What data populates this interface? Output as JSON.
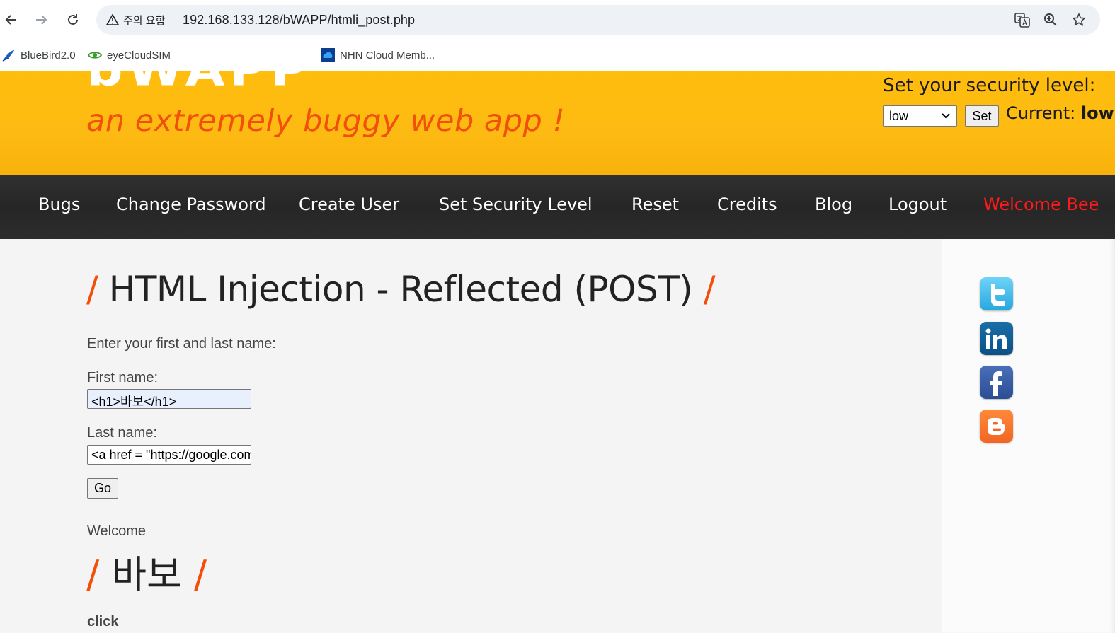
{
  "browser": {
    "security_chip": "주의 요함",
    "url": "192.168.133.128/bWAPP/htmli_post.php",
    "bookmarks": [
      "BlueBird2.0",
      "eyeCloudSIM",
      "NHN Cloud Memb..."
    ]
  },
  "header": {
    "logo": "bWAPP",
    "tagline": "an extremely buggy web app !",
    "security_label": "Set your security level:",
    "security_selected": "low",
    "set_button": "Set",
    "current_label": "Current:",
    "current_value": "low"
  },
  "menu": {
    "items": [
      "Bugs",
      "Change Password",
      "Create User",
      "Set Security Level",
      "Reset",
      "Credits",
      "Blog",
      "Logout"
    ],
    "welcome": "Welcome Bee"
  },
  "main": {
    "title_slash": "/",
    "title": "HTML Injection - Reflected (POST)",
    "intro": "Enter your first and last name:",
    "first_label": "First name:",
    "first_value": "<h1>바보</h1>",
    "last_label": "Last name:",
    "last_value": "<a href = \"https://google.com\">click</a>",
    "go_button": "Go",
    "welcome_text": "Welcome",
    "injected_heading": "바보",
    "injected_link": "click"
  },
  "colors": {
    "header_bg": "#fdba12",
    "accent_orange": "#f24f0a",
    "menu_bg": "#2a2a2a",
    "welcome_red": "#ff1a1a"
  }
}
